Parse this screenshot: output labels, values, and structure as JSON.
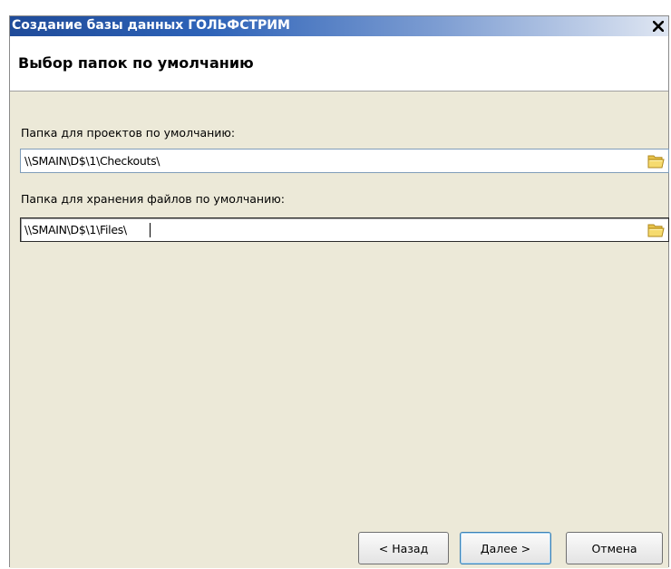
{
  "window": {
    "title": "Создание базы данных ГОЛЬФСТРИМ",
    "close_symbol": "x"
  },
  "header": {
    "title": "Выбор папок по умолчанию"
  },
  "fields": {
    "projects_label": "Папка для проектов по умолчанию:",
    "projects_value": "\\\\SMAIN\\D$\\1\\Checkouts\\",
    "files_label": "Папка для хранения файлов по умолчанию:",
    "files_value": "\\\\SMAIN\\D$\\1\\Files\\"
  },
  "buttons": {
    "back": "< Назад",
    "next": "Далее >",
    "cancel": "Отмена"
  },
  "icons": {
    "folder": "folder-open-icon",
    "close": "close-icon"
  },
  "colors": {
    "title_bar_start": "#1f4b99",
    "dialog_bg": "#ece9d8",
    "folder_yellow": "#f2d35a"
  }
}
